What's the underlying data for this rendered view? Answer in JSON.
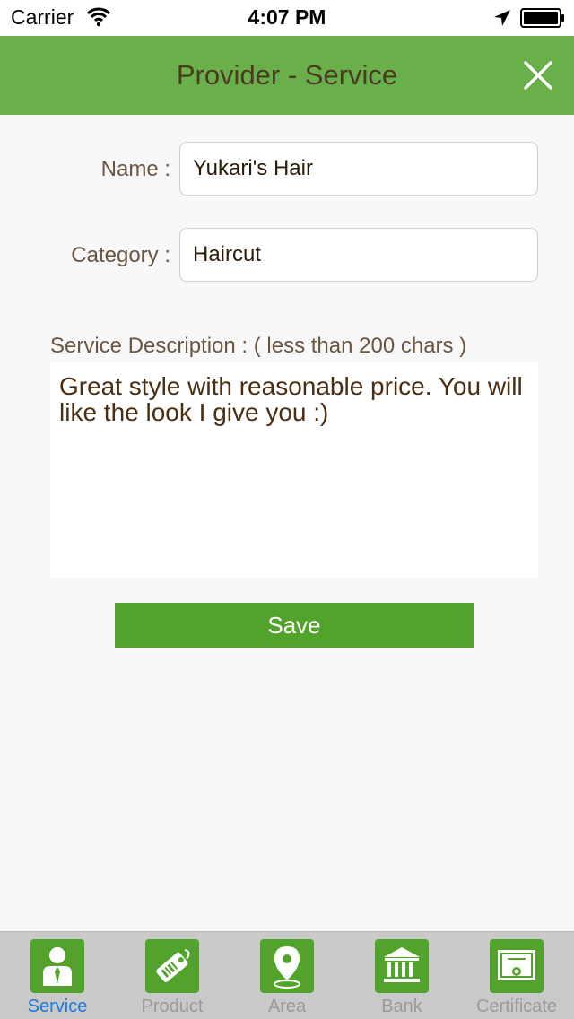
{
  "status_bar": {
    "carrier": "Carrier",
    "time": "4:07 PM"
  },
  "header": {
    "title": "Provider - Service"
  },
  "form": {
    "name_label": "Name :",
    "name_value": "Yukari's Hair",
    "category_label": "Category :",
    "category_value": "Haircut",
    "description_label": "Service Description : ( less than 200 chars )",
    "description_value": "Great style with reasonable price.  You will like the look I give you :)",
    "save_label": "Save"
  },
  "tabs": [
    {
      "label": "Service",
      "icon": "person-icon",
      "active": true
    },
    {
      "label": "Product",
      "icon": "tag-icon",
      "active": false
    },
    {
      "label": "Area",
      "icon": "map-pin-icon",
      "active": false
    },
    {
      "label": "Bank",
      "icon": "bank-icon",
      "active": false
    },
    {
      "label": "Certificate",
      "icon": "certificate-icon",
      "active": false
    }
  ],
  "colors": {
    "accent": "#6ab04a",
    "button": "#52a32c",
    "active_tab": "#1a7ae0",
    "inactive_tab": "#9a9a9a"
  }
}
